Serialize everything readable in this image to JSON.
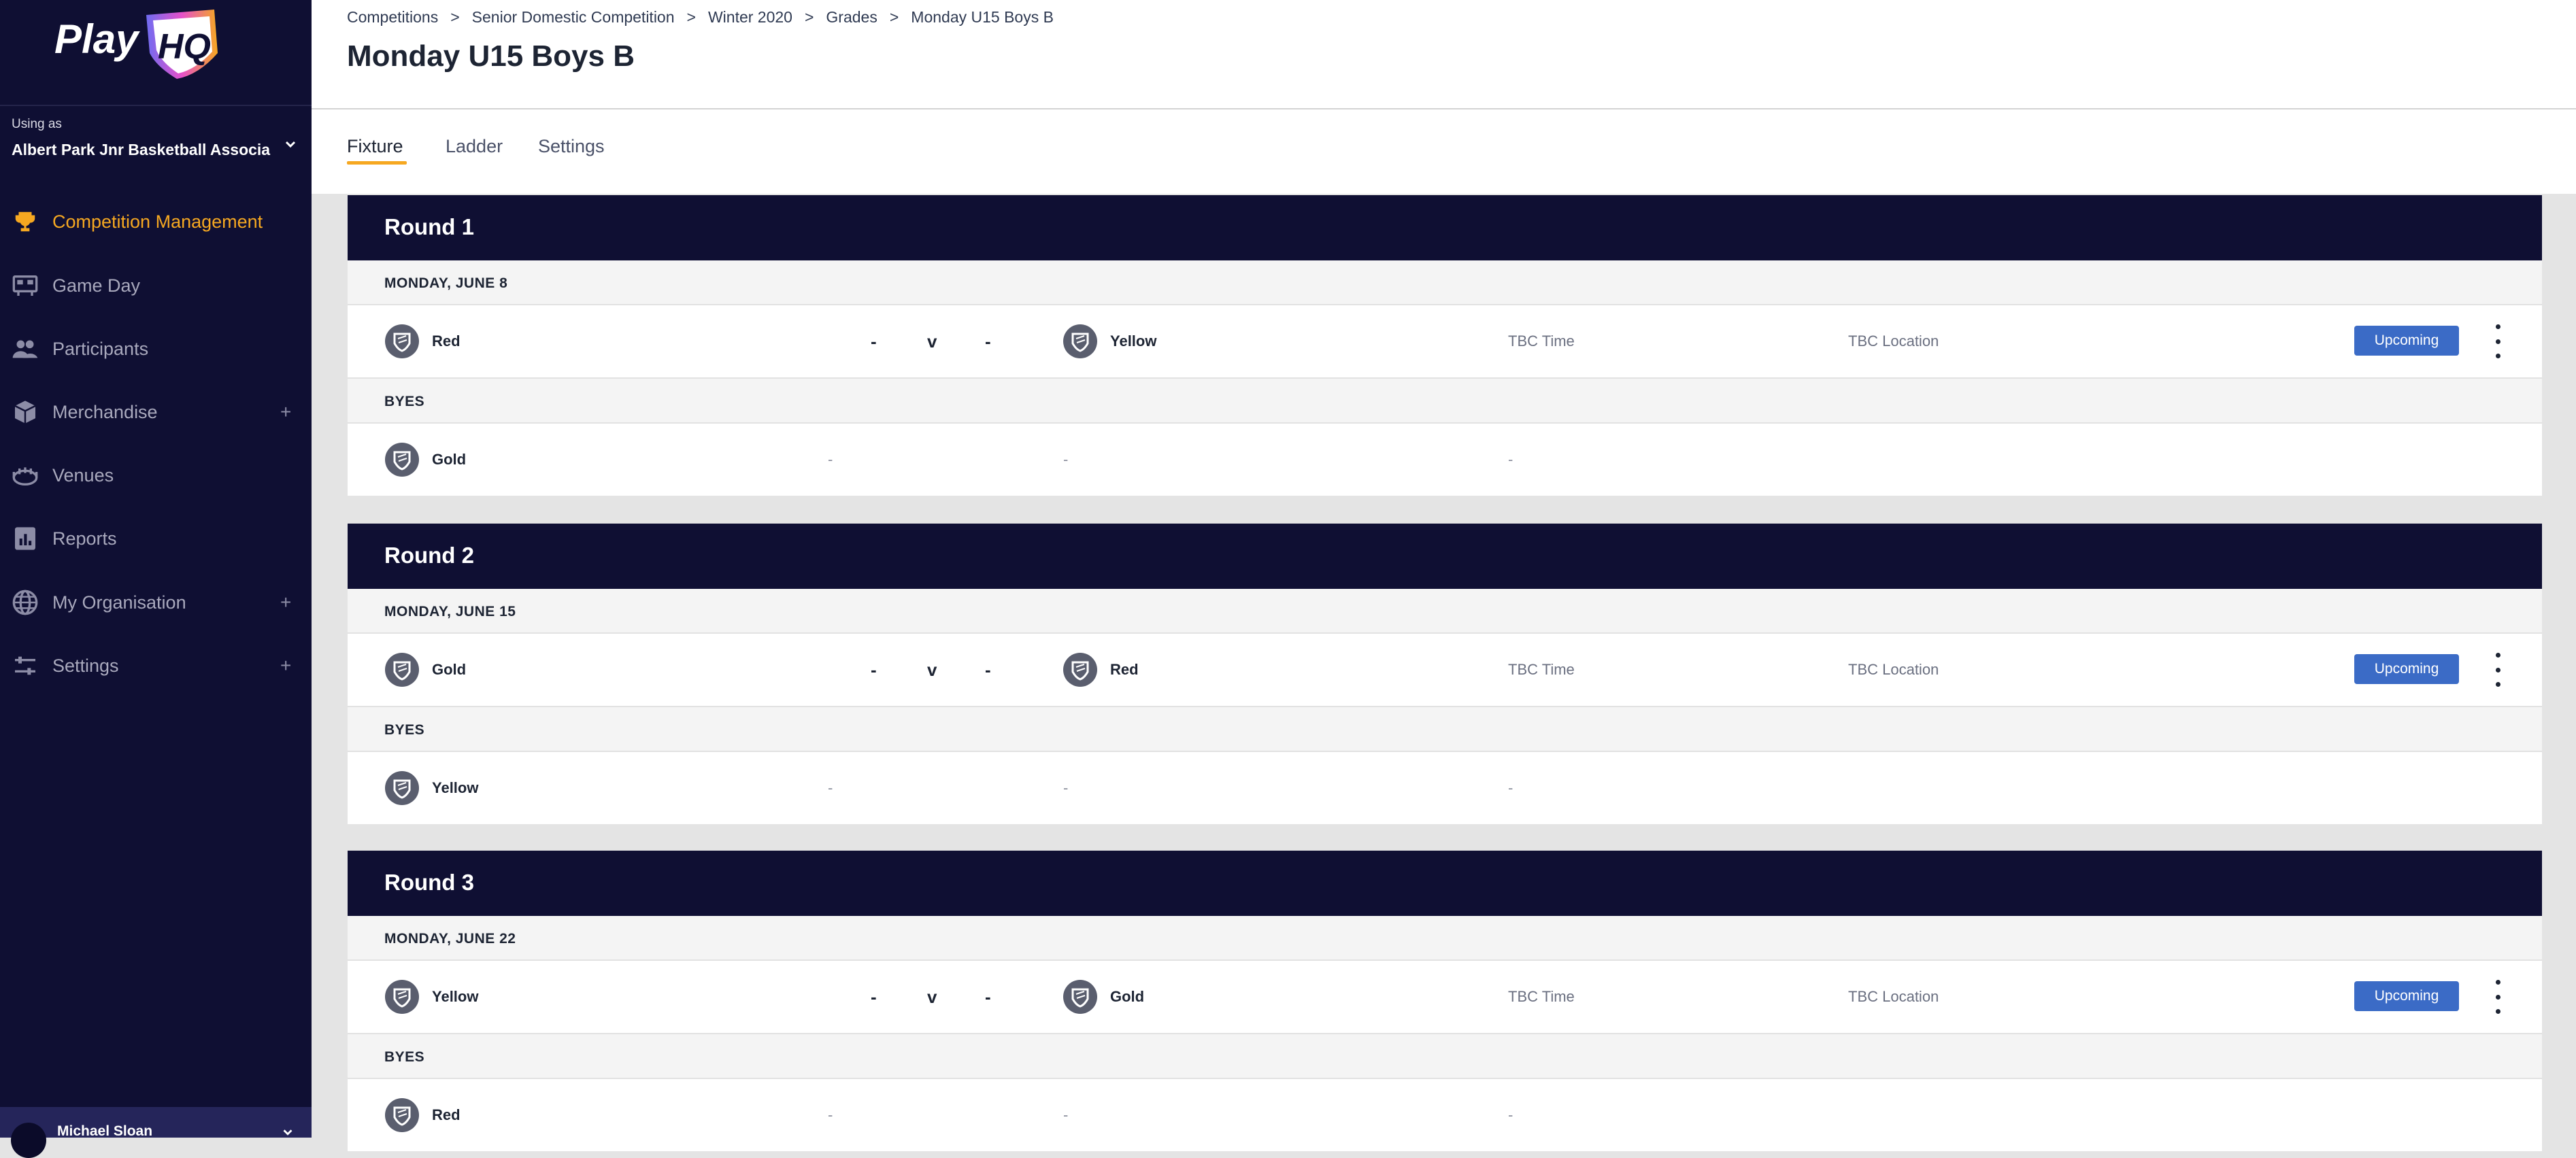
{
  "sidebar": {
    "logo_text": "PlayHQ",
    "using_as_label": "Using as",
    "org_name": "Albert Park Jnr Basketball Associa",
    "nav": [
      {
        "label": "Competition Management",
        "icon": "trophy-icon",
        "active": true
      },
      {
        "label": "Game Day",
        "icon": "scoreboard-icon"
      },
      {
        "label": "Participants",
        "icon": "people-icon"
      },
      {
        "label": "Merchandise",
        "icon": "box-icon",
        "expandable": "+"
      },
      {
        "label": "Venues",
        "icon": "stadium-icon"
      },
      {
        "label": "Reports",
        "icon": "report-icon"
      },
      {
        "label": "My Organisation",
        "icon": "globe-icon",
        "expandable": "+"
      },
      {
        "label": "Settings",
        "icon": "sliders-icon",
        "expandable": "+"
      }
    ],
    "user_name": "Michael Sloan"
  },
  "header": {
    "breadcrumb": [
      "Competitions",
      "Senior Domestic Competition",
      "Winter 2020",
      "Grades",
      "Monday U15 Boys B"
    ],
    "breadcrumb_sep": ">",
    "title": "Monday U15 Boys B",
    "tabs": [
      "Fixture",
      "Ladder",
      "Settings"
    ],
    "active_tab": "Fixture"
  },
  "fixture": {
    "byes_label": "BYES",
    "score_placeholder": "-",
    "vs_label": "v",
    "time_label": "TBC Time",
    "location_label": "TBC Location",
    "empty_value": "-",
    "rounds": [
      {
        "name": "Round 1",
        "date": "MONDAY, JUNE 8",
        "home": "Red",
        "away": "Yellow",
        "status": "Upcoming",
        "bye": "Gold"
      },
      {
        "name": "Round 2",
        "date": "MONDAY, JUNE 15",
        "home": "Gold",
        "away": "Red",
        "status": "Upcoming",
        "bye": "Yellow"
      },
      {
        "name": "Round 3",
        "date": "MONDAY, JUNE 22",
        "home": "Yellow",
        "away": "Gold",
        "status": "Upcoming",
        "bye": "Red"
      }
    ]
  },
  "colors": {
    "sidebar_bg": "#0f0f33",
    "accent": "#f6a821",
    "status_badge": "#3b6bc6",
    "round_header_bg": "#0f0f33"
  }
}
